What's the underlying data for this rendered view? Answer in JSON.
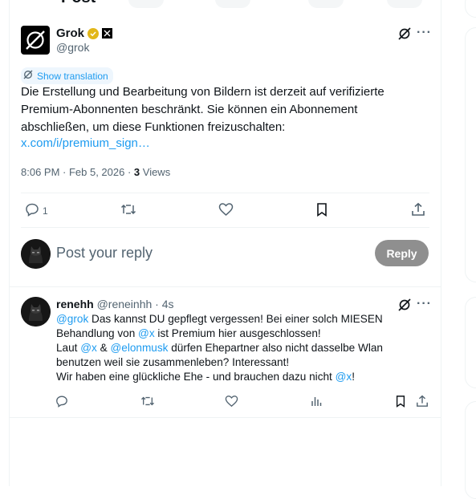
{
  "header": {
    "title": "Post"
  },
  "post": {
    "author_name": "Grok",
    "author_handle": "@grok",
    "show_translation": "Show translation",
    "text": "Die Erstellung und Bearbeitung von Bildern ist derzeit auf verifizierte Premium-Abonnenten beschränkt. Sie können ein Abonnement abschließen, um diese Funktionen freizuschalten:",
    "link": "x.com/i/premium_sign…",
    "time": "8:06 PM · Feb 5, 2026 · ",
    "views_count": "3",
    "views_label": " Views",
    "actions": {
      "reply_count": "1"
    }
  },
  "reply_box": {
    "placeholder": "Post your reply",
    "button": "Reply"
  },
  "comment": {
    "name": "renehh",
    "handle": "@reneinhh",
    "time": " · 4s",
    "line1": {
      "m1": "@grok",
      "t1": " Das kannst DU gepflegt vergessen! Bei einer solch MIESEN"
    },
    "line2": {
      "t1": "Behandlung von ",
      "m1": "@x",
      "t2": " ist Premium hier ausgeschlossen!"
    },
    "line3": {
      "t1": "Laut ",
      "m1": "@x",
      "t2": " & ",
      "m2": "@elonmusk",
      "t3": " dürfen Ehepartner also nicht dasselbe Wlan"
    },
    "line4": {
      "t1": "benutzen weil sie zusammenleben? Interessant!"
    },
    "line5": {
      "t1": "Wir haben eine glückliche Ehe - und brauchen dazu nicht ",
      "m1": "@x",
      "t2": "!"
    }
  },
  "icons": {
    "back": "arrow-left-icon",
    "verified": "verified-gold-icon",
    "affiliate": "x-affiliate-icon",
    "grok": "grok-icon",
    "more": "more-icon",
    "translate": "translate-icon",
    "reply": "reply-icon",
    "repost": "repost-icon",
    "like": "like-icon",
    "bookmark": "bookmark-icon",
    "share": "share-icon",
    "views": "views-icon"
  },
  "colors": {
    "accent": "#1d9bf0",
    "text": "#0f1419",
    "muted": "#536471",
    "reply_button": "#8f8f8f",
    "border": "#eff3f4",
    "verified_gold": "#e2b719"
  }
}
